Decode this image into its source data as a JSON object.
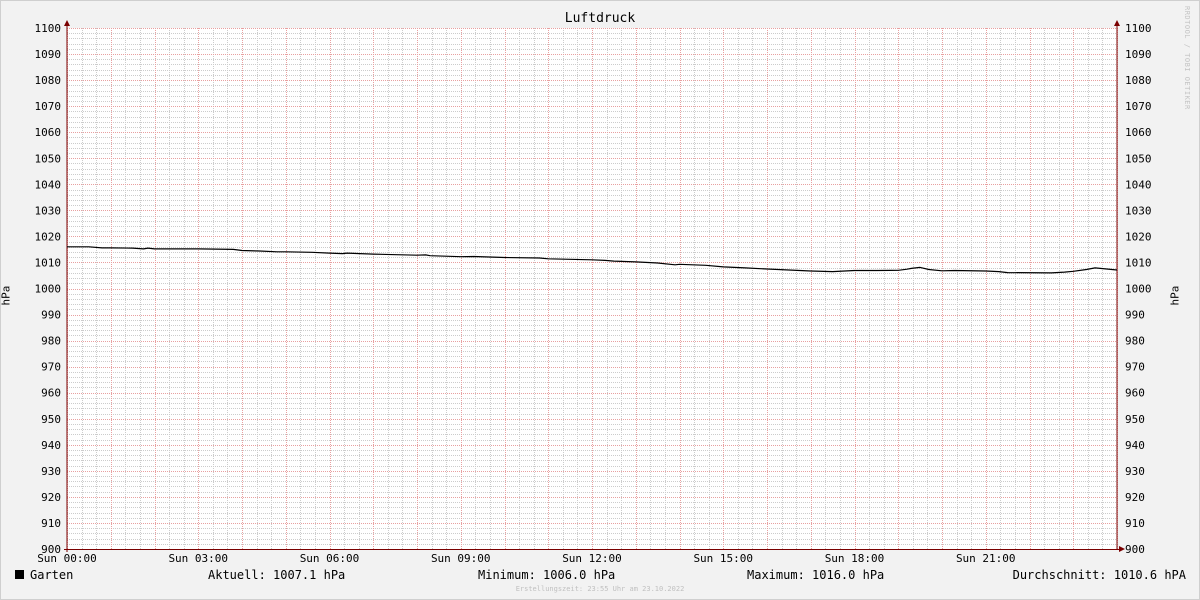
{
  "chart_data": {
    "type": "line",
    "title": "Luftdruck",
    "ylabel": "hPa",
    "ylabel_right": "hPa",
    "ylim": [
      900,
      1100
    ],
    "yticks": [
      900,
      910,
      920,
      930,
      940,
      950,
      960,
      970,
      980,
      990,
      1000,
      1010,
      1020,
      1030,
      1040,
      1050,
      1060,
      1070,
      1080,
      1090,
      1100
    ],
    "xlim": [
      0,
      24
    ],
    "xticks": [
      {
        "hour": 0,
        "label": "Sun 00:00"
      },
      {
        "hour": 3,
        "label": "Sun 03:00"
      },
      {
        "hour": 6,
        "label": "Sun 06:00"
      },
      {
        "hour": 9,
        "label": "Sun 09:00"
      },
      {
        "hour": 12,
        "label": "Sun 12:00"
      },
      {
        "hour": 15,
        "label": "Sun 15:00"
      },
      {
        "hour": 18,
        "label": "Sun 18:00"
      },
      {
        "hour": 21,
        "label": "Sun 21:00"
      }
    ],
    "grid": true,
    "series": [
      {
        "name": "Garten",
        "color": "#000000",
        "x": [
          0,
          0.5,
          0.8,
          1.0,
          1.5,
          1.75,
          1.85,
          2.0,
          2.2,
          3.0,
          3.8,
          4.0,
          4.4,
          4.8,
          5.0,
          5.6,
          6.0,
          6.3,
          6.4,
          7.0,
          8.0,
          8.2,
          8.3,
          9.0,
          9.3,
          10.0,
          10.8,
          11.0,
          12.0,
          12.3,
          12.5,
          13.0,
          13.5,
          13.9,
          14.0,
          14.6,
          15.0,
          15.5,
          16.0,
          16.5,
          17.0,
          17.5,
          18.0,
          18.5,
          19.0,
          19.2,
          19.3,
          19.5,
          19.7,
          20.0,
          20.3,
          21.0,
          21.3,
          21.5,
          22.5,
          22.8,
          23.0,
          23.3,
          23.5,
          24.0
        ],
        "values": [
          1016.0,
          1016.0,
          1015.6,
          1015.6,
          1015.5,
          1015.2,
          1015.5,
          1015.2,
          1015.2,
          1015.2,
          1015.0,
          1014.6,
          1014.4,
          1014.1,
          1014.1,
          1013.9,
          1013.6,
          1013.4,
          1013.6,
          1013.2,
          1012.8,
          1012.9,
          1012.6,
          1012.2,
          1012.3,
          1011.9,
          1011.7,
          1011.4,
          1011.0,
          1010.8,
          1010.5,
          1010.2,
          1009.8,
          1009.1,
          1009.3,
          1008.9,
          1008.3,
          1007.9,
          1007.5,
          1007.1,
          1006.7,
          1006.5,
          1006.9,
          1006.9,
          1007.0,
          1007.4,
          1007.7,
          1008.1,
          1007.3,
          1006.8,
          1006.9,
          1006.7,
          1006.5,
          1006.1,
          1006.0,
          1006.3,
          1006.6,
          1007.3,
          1007.9,
          1007.1
        ]
      }
    ]
  },
  "legend": {
    "series_name": "Garten",
    "current": "Aktuell: 1007.1 hPa",
    "minimum": "Minimum: 1006.0 hPa",
    "maximum": "Maximum: 1016.0 hPa",
    "average": "Durchschnitt: 1010.6 hPA"
  },
  "footer": "Erstellungszeit: 23:55 Uhr am 23.10.2022",
  "watermark": "RRDTOOL / TOBI OETIKER",
  "colors": {
    "background": "#f2f2f2",
    "plot_background": "#ffffff",
    "major_grid": "#e8a0a0",
    "minor_grid": "#cccccc",
    "axis": "#7a0000",
    "line": "#000000"
  }
}
